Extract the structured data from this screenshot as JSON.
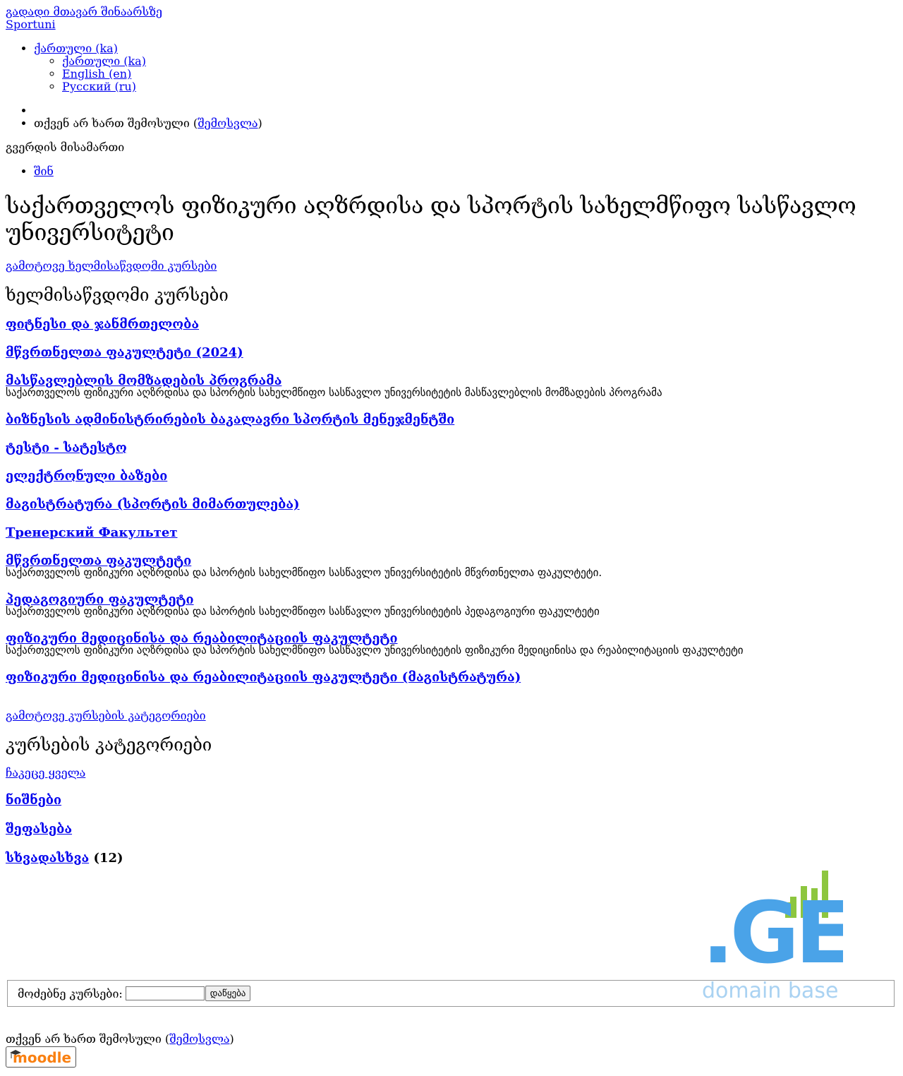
{
  "skip_main": "გადადი მთავარ შინაარსზე",
  "site_name": "Sportuni",
  "lang": {
    "current": "ქართული (ka)",
    "options": [
      "ქართული (ka)",
      "English (en)",
      "Русский (ru)"
    ]
  },
  "user": {
    "not_logged_prefix": "თქვენ არ ხართ შემოსული (",
    "login_link": "შემოსვლა",
    "suffix": ")"
  },
  "breadcrumb": {
    "label": "გვერდის მისამართი",
    "home": "შინ"
  },
  "page_title": "საქართველოს ფიზიკური აღზრდისა და სპორტის სახელმწიფო სასწავლო უნივერსიტეტი",
  "courses": {
    "skip": "გამოტოვე ხელმისაწვდომი კურსები",
    "heading": "ხელმისაწვდომი კურსები",
    "items": [
      {
        "name": "ფიტნესი და ჯანმრთელობა",
        "summary": ""
      },
      {
        "name": "მწვრთნელთა ფაკულტეტი (2024)",
        "summary": ""
      },
      {
        "name": "მასწავლებლის მომზადების პროგრამა",
        "summary": "საქართველოს ფიზიკური აღზრდისა და სპორტის სახელმწიფო სასწავლო უნივერსიტეტის მასწავლებლის მომზადების პროგრამა"
      },
      {
        "name": "ბიზნესის ადმინისტრირების ბაკალავრი სპორტის მენეჯმენტში",
        "summary": ""
      },
      {
        "name": "ტესტი - სატესტო",
        "summary": ""
      },
      {
        "name": "ელექტრონული ბაზები",
        "summary": ""
      },
      {
        "name": "მაგისტრატურა (სპორტის მიმართულება)",
        "summary": ""
      },
      {
        "name": "Тренерский Факультет",
        "summary": ""
      },
      {
        "name": "მწვრთნელთა ფაკულტეტი",
        "summary": "საქართველოს ფიზიკური აღზრდისა და სპორტის სახელმწიფო სასწავლო უნივერსიტეტის მწვრთნელთა ფაკულტეტი."
      },
      {
        "name": "პედაგოგიური ფაკულტეტი",
        "summary": "საქართველოს ფიზიკური აღზრდისა და სპორტის სახელმწიფო სასწავლო უნივერსიტეტის პედაგოგიური ფაკულტეტი"
      },
      {
        "name": "ფიზიკური მედიცინისა და რეაბილიტაციის ფაკულტეტი",
        "summary": "საქართველოს ფიზიკური აღზრდისა და სპორტის სახელმწიფო სასწავლო უნივერსიტეტის ფიზიკური მედიცინისა და რეაბილიტაციის ფაკულტეტი"
      },
      {
        "name": "ფიზიკური მედიცინისა და რეაბილიტაციის ფაკულტეტი (მაგისტრატურა)",
        "summary": ""
      }
    ]
  },
  "categories": {
    "skip": "გამოტოვე კურსების კატეგორიები",
    "heading": "კურსების კატეგორიები",
    "collapse_all": "ჩაკეცე ყველა",
    "items": [
      {
        "name": "ნიშნები",
        "count": ""
      },
      {
        "name": "შეფასება",
        "count": ""
      },
      {
        "name": "სხვადასხვა",
        "count": "(12)"
      }
    ]
  },
  "search": {
    "label": "მოძებნე კურსები:",
    "value": "",
    "button": "დაწყება"
  },
  "footer": {
    "not_logged_prefix": "თქვენ არ ხართ შემოსული (",
    "login_link": "შემოსვლა",
    "suffix": ")",
    "moodle_logo_text": "moodle"
  },
  "ge_logo": {
    "text": ".GE",
    "subtext": "domain base",
    "blue": "#4aa3e8",
    "green": "#8dc63f"
  }
}
